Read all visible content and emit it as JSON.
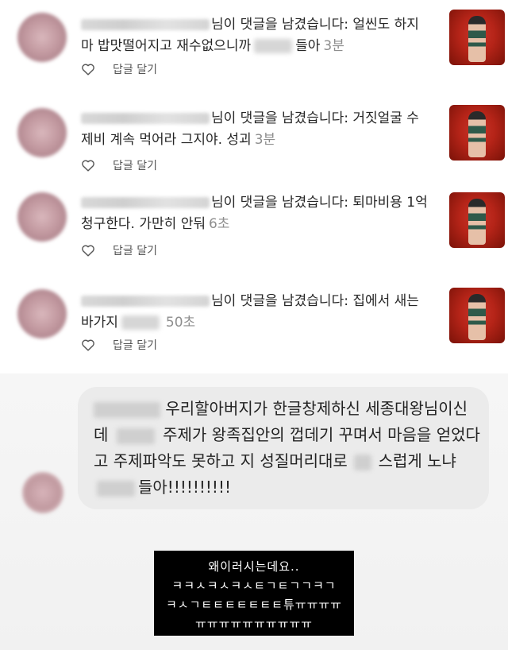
{
  "notifications": [
    {
      "action_text": "님이 댓글을 남겼습니다: ",
      "comment_a": "얼씬도 하지 마 밥맛떨어지고 재수없으니까",
      "comment_b": "들아",
      "time": "3분",
      "reply_label": "답글 달기"
    },
    {
      "action_text": "님이 댓글을 남겼습니다: ",
      "comment_a": "거짓얼굴 수제비 계속 먹어라 그지야. 성괴",
      "comment_b": "",
      "time": "3분",
      "reply_label": "답글 달기"
    },
    {
      "action_text": "님이 댓글을 남겼습니다: ",
      "comment_a": "퇴마비용 1억 청구한다. 가만히 안둬",
      "comment_b": "",
      "time": "6초",
      "reply_label": "답글 달기"
    },
    {
      "action_text": "님이 댓글을 남겼습니다: ",
      "comment_a": "집에서 새는 바가지",
      "comment_b": "",
      "time": "50초",
      "reply_label": "답글 달기"
    }
  ],
  "comment_bubble": {
    "part1": "우리할아버지가 한글창제하신 세종대왕님이신데",
    "part2": "주제가 왕족집안의 껍데기 꾸며서 마음을 얻었다고 주제파악도 못하고 지 성질머리대로",
    "part3": "스럽게 노냐",
    "part4": "들아!!!!!!!!!!"
  },
  "caption": {
    "line1": "왜이러시는데요..",
    "line2": "ㅋㅋㅅㅋㅅㅋㅅㅌㄱㅌㄱㄱㅋㄱ",
    "line3": "ㅋㅅㄱㅌㅌㅌㅌㅌㅌㅌ튜ㅠㅠㅠㅠ",
    "line4": "ㅠㅠㅠㅠㅠㅠㅠㅠㅠㅠ"
  },
  "colors": {
    "bubble_bg": "#ebebeb",
    "thumb_red": "#b52418",
    "time_gray": "#8e8e8e",
    "caption_bg": "#000000"
  },
  "icons": [
    "heart-outline-icon",
    "post-thumbnail"
  ]
}
